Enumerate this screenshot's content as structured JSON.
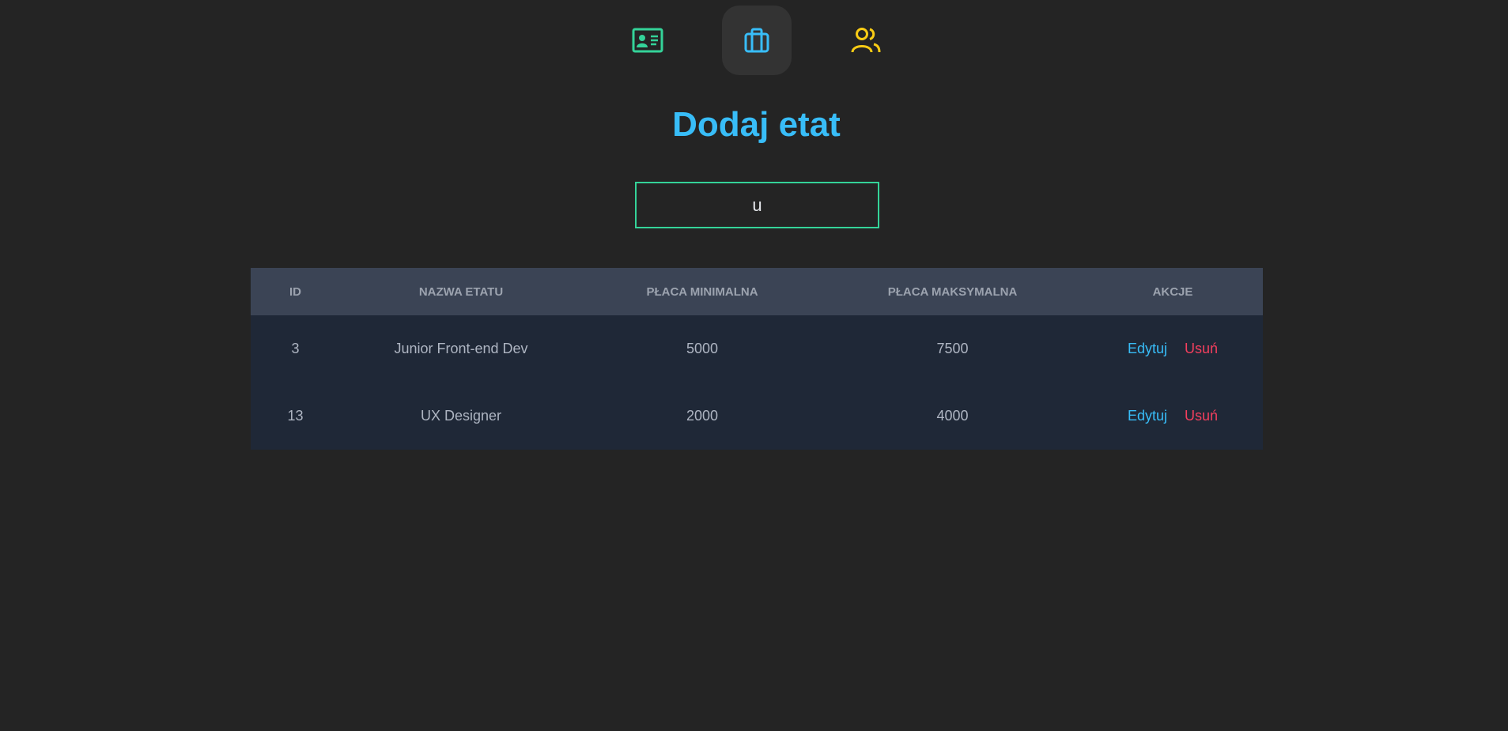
{
  "colors": {
    "background": "#242424",
    "title": "#38bdf8",
    "accent_green": "#34d399",
    "accent_blue": "#38bdf8",
    "accent_yellow": "#facc15",
    "edit": "#38bdf8",
    "delete": "#f43f5e"
  },
  "nav": {
    "items": [
      {
        "icon": "id-card-icon",
        "active": false
      },
      {
        "icon": "briefcase-icon",
        "active": true
      },
      {
        "icon": "users-icon",
        "active": false
      }
    ]
  },
  "page": {
    "title": "Dodaj etat"
  },
  "search": {
    "value": "u",
    "placeholder": ""
  },
  "table": {
    "headers": {
      "id": "ID",
      "name": "NAZWA ETATU",
      "min": "PŁACA MINIMALNA",
      "max": "PŁACA MAKSYMALNA",
      "actions": "AKCJE"
    },
    "rows": [
      {
        "id": "3",
        "name": "Junior Front-end Dev",
        "min": "5000",
        "max": "7500",
        "edit": "Edytuj",
        "delete": "Usuń"
      },
      {
        "id": "13",
        "name": "UX Designer",
        "min": "2000",
        "max": "4000",
        "edit": "Edytuj",
        "delete": "Usuń"
      }
    ]
  }
}
